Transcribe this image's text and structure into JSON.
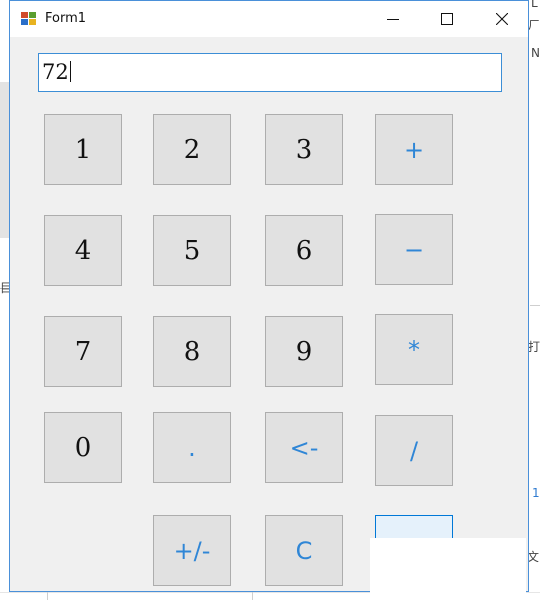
{
  "window": {
    "title": "Form1",
    "icon": "winforms-app-icon",
    "controls": [
      "minimize-icon",
      "maximize-icon",
      "close-icon"
    ]
  },
  "display": {
    "value": "72"
  },
  "keypad": {
    "btn_1": "1",
    "btn_2": "2",
    "btn_3": "3",
    "btn_plus": "+",
    "btn_4": "4",
    "btn_5": "5",
    "btn_6": "6",
    "btn_minus": "−",
    "btn_7": "7",
    "btn_8": "8",
    "btn_9": "9",
    "btn_multiply": "*",
    "btn_0": "0",
    "btn_dot": ".",
    "btn_backspace": "<-",
    "btn_divide": "/",
    "btn_negate": "+/-",
    "btn_clear": "C",
    "btn_equals": ""
  },
  "background": {
    "fragments": [
      "L",
      "ㄏ",
      "目",
      "N",
      "打",
      "1",
      "文"
    ]
  },
  "colors": {
    "window_border": "#4a90d9",
    "window_bg": "#f0f0f0",
    "button_bg": "#e1e1e1",
    "button_border": "#adadad",
    "operator_text": "#2f86d6",
    "focus_button_bg": "#e5f1fb",
    "focus_button_border": "#0078d7"
  }
}
